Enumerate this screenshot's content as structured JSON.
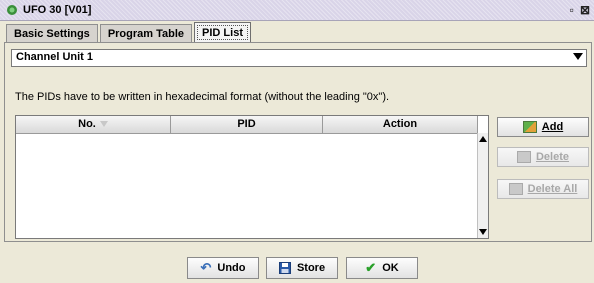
{
  "window": {
    "title": "UFO 30 [V01]",
    "icon": "app-icon",
    "restore_glyph": "▫",
    "close_glyph": "⊠"
  },
  "tabs": [
    {
      "label": "Basic Settings",
      "active": false
    },
    {
      "label": "Program Table",
      "active": false
    },
    {
      "label": "PID List",
      "active": true
    }
  ],
  "channel_select": {
    "selected": "Channel Unit 1"
  },
  "info_text": "The PIDs have to be written in hexadecimal format (without the leading \"0x\").",
  "table": {
    "columns": [
      "No.",
      "PID",
      "Action"
    ],
    "rows": []
  },
  "side_buttons": {
    "add": {
      "label": "Add",
      "enabled": true,
      "icon": "add-icon"
    },
    "delete": {
      "label": "Delete",
      "enabled": false,
      "icon": "delete-icon"
    },
    "delete_all": {
      "label": "Delete All",
      "enabled": false,
      "icon": "delete-all-icon"
    }
  },
  "footer_buttons": {
    "undo": {
      "label": "Undo",
      "icon": "undo-icon"
    },
    "store": {
      "label": "Store",
      "icon": "save-icon"
    },
    "ok": {
      "label": "OK",
      "icon": "checkmark-icon"
    }
  },
  "colors": {
    "checkmark": "#2aa02a",
    "save": "#2a5aa8",
    "undo": "#3a6fb8"
  }
}
